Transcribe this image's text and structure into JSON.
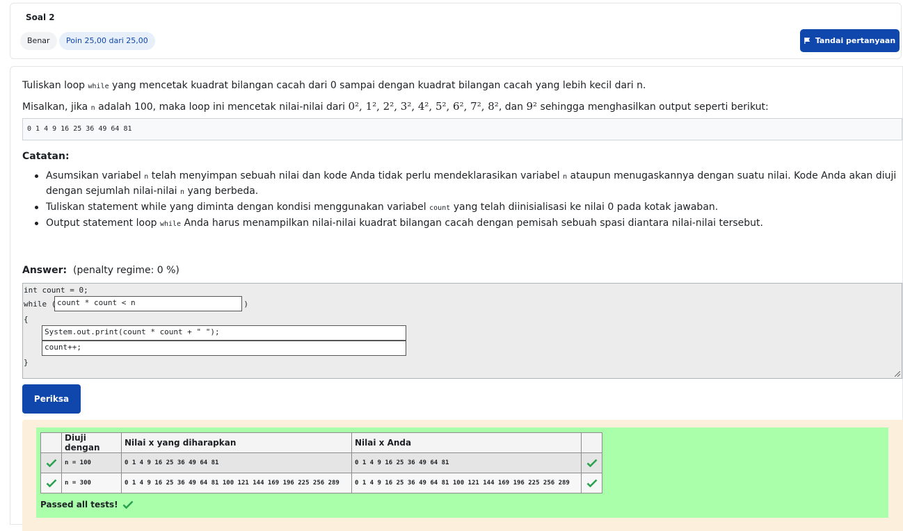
{
  "question": {
    "title": "Soal 2",
    "status": "Benar",
    "points": "Poin 25,00 dari 25,00",
    "flag_label": "Tandai pertanyaan"
  },
  "prompt": {
    "line1_a": "Tuliskan loop ",
    "line1_code": "while",
    "line1_b": " yang mencetak kuadrat bilangan cacah dari 0 sampai dengan kuadrat bilangan cacah yang lebih kecil dari n.",
    "line2_a": "Misalkan, jika ",
    "line2_code": "n",
    "line2_b": " adalah 100, maka loop ini mencetak nilai-nilai dari ",
    "line2_math": "0², 1², 2², 3², 4², 5², 6², 7², 8²",
    "line2_c": ", dan ",
    "line2_math2": "9²",
    "line2_d": " sehingga menghasilkan output seperti berikut:",
    "sample_output": "0 1 4 9 16 25 36 49 64 81"
  },
  "notes": {
    "heading": "Catatan:",
    "n1_a": "Asumsikan variabel ",
    "n1_code1": "n",
    "n1_b": " telah menyimpan sebuah nilai dan kode Anda tidak perlu mendeklarasikan variabel ",
    "n1_code2": "n",
    "n1_c": " ataupun menugaskannya dengan suatu nilai. Kode Anda akan diuji dengan sejumlah nilai-nilai ",
    "n1_code3": "n",
    "n1_d": " yang berbeda.",
    "n2_a": "Tuliskan statement while yang diminta dengan kondisi menggunakan variabel ",
    "n2_code": "count",
    "n2_b": " yang telah diinisialisasi ke nilai 0 pada kotak jawaban.",
    "n3_a": "Output statement loop ",
    "n3_code": "while",
    "n3_b": " Anda harus menampilkan nilai-nilai kuadrat bilangan cacah dengan pemisah sebuah spasi diantara nilai-nilai tersebut."
  },
  "answer": {
    "label": "Answer:",
    "penalty": "(penalty regime: 0 %)",
    "line1": "int count = 0;",
    "line2_a": "while (",
    "line2_b": ")",
    "cond_value": "count * count < n",
    "line3": "{",
    "stmt1_value": "System.out.print(count * count + \" \");",
    "stmt2_value": "count++;",
    "line_last": "}"
  },
  "check_button": "Periksa",
  "results": {
    "headers": [
      "",
      "Diuji dengan",
      "Nilai x yang diharapkan",
      "Nilai x Anda",
      ""
    ],
    "rows": [
      {
        "test": "n = 100",
        "expected": "0 1 4 9 16 25 36 49 64 81",
        "got": "0 1 4 9 16 25 36 49 64 81"
      },
      {
        "test": "n = 300",
        "expected": "0 1 4 9 16 25 36 49 64 81 100 121 144 169 196 225 256 289",
        "got": "0 1 4 9 16 25 36 49 64 81 100 121 144 169 196 225 256 289"
      }
    ],
    "passed": "Passed all tests!"
  },
  "colors": {
    "primary": "#0f47ad",
    "pass_bg": "#aaffaa",
    "feedback_bg": "#fcefdc",
    "tick": "#2aa14e"
  }
}
